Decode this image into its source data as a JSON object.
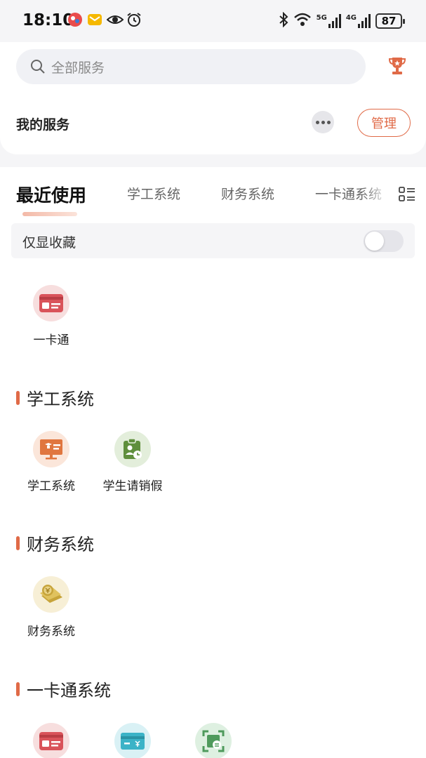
{
  "status_bar": {
    "time": "18:10",
    "network_5g": "5G",
    "network_4g": "4G",
    "battery": "87"
  },
  "header": {
    "search_placeholder": "全部服务",
    "my_services": "我的服务",
    "manage_label": "管理"
  },
  "tabs": [
    {
      "label": "最近使用",
      "active": true
    },
    {
      "label": "学工系统",
      "active": false
    },
    {
      "label": "财务系统",
      "active": false
    },
    {
      "label": "一卡通系统",
      "active": false
    }
  ],
  "favorites_toggle": {
    "label": "仅显收藏",
    "enabled": false
  },
  "recent": {
    "apps": [
      {
        "label": "一卡通",
        "icon": "id-card-icon"
      }
    ]
  },
  "sections": [
    {
      "title": "学工系统",
      "apps": [
        {
          "label": "学工系统",
          "icon": "teacher-board-icon"
        },
        {
          "label": "学生请销假",
          "icon": "leave-request-icon"
        }
      ]
    },
    {
      "title": "财务系统",
      "apps": [
        {
          "label": "财务系统",
          "icon": "money-stack-icon"
        }
      ]
    },
    {
      "title": "一卡通系统",
      "apps": [
        {
          "label": "",
          "icon": "id-card-icon"
        },
        {
          "label": "",
          "icon": "payment-card-icon"
        },
        {
          "label": "",
          "icon": "scan-code-icon"
        }
      ]
    }
  ],
  "colors": {
    "accent": "#e06a47",
    "card_red": "#d9535a",
    "edu_orange": "#e0763f",
    "leave_green": "#5f8f3c",
    "finance_gold": "#c7a43a",
    "payment_teal": "#3bb3c7",
    "scan_green": "#4f9a5c"
  }
}
